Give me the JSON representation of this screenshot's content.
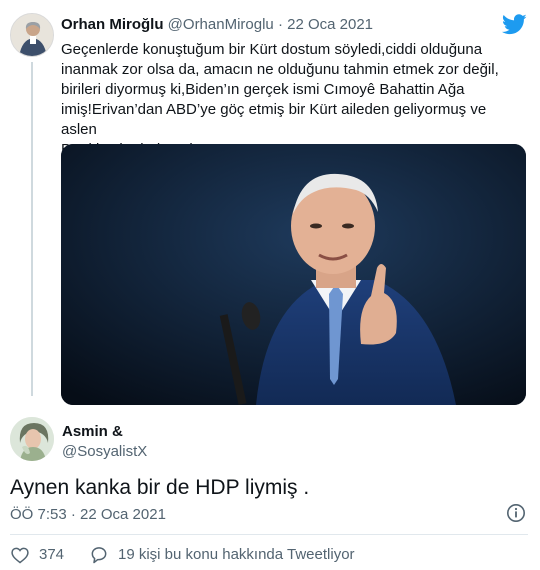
{
  "quoted_tweet": {
    "author_name": "Orhan Miroğlu",
    "handle": "@OrhanMiroglu",
    "separator": "·",
    "date": "22 Oca 2021",
    "text_lines": [
      "Geçenlerde konuştuğum bir Kürt dostum söyledi,ciddi olduğuna",
      "inanmak zor olsa da, amacın ne olduğunu tahmin etmek zor değil,",
      "birileri diyormuş ki,Biden’ın gerçek ismi Cımoyê Bahattin Ağa",
      "imiş!Erivan’dan ABD’ye göç etmiş bir Kürt aileden geliyormuş ve aslen",
      "Bıruki aşiretindenmiş!"
    ]
  },
  "reply_tweet": {
    "author_name": "Asmin &",
    "handle": "@SosyalistX",
    "text": "Aynen kanka bir de HDP liymiş  .",
    "timestamp": "ÖÖ 7:53 · 22 Oca 2021"
  },
  "actions": {
    "like_count": "374",
    "talking_text": "19 kişi bu konu hakkında Tweetliyor"
  },
  "icons": {
    "twitter": "twitter-bird-icon",
    "info": "info-icon",
    "like": "heart-icon",
    "reply": "speech-bubble-icon"
  },
  "colors": {
    "twitter_blue": "#1d9bf0",
    "muted_text": "#536471",
    "divider": "#e1e8ed"
  }
}
